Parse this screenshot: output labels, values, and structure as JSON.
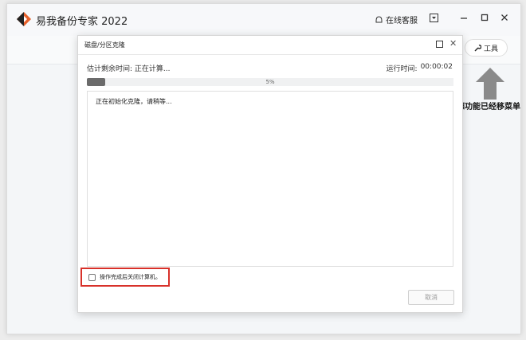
{
  "app": {
    "title": "易我备份专家 2022",
    "support_label": "在线客服",
    "accent_color": "#e8622c"
  },
  "background": {
    "tools_label": "工具",
    "hint_text": "德功能已经移菜单"
  },
  "dialog": {
    "title": "磁盘/分区克隆",
    "estimate_label": "估计剩余时间:",
    "estimate_value": "正在计算...",
    "runtime_label": "运行时间:",
    "runtime_value": "00:00:02",
    "progress_percent": 5,
    "progress_text": "5%",
    "log_text": "正在初始化克隆，请稍等...",
    "shutdown_label": "操作完成后关闭计算机。",
    "shutdown_checked": false,
    "cancel_label": "取消"
  }
}
